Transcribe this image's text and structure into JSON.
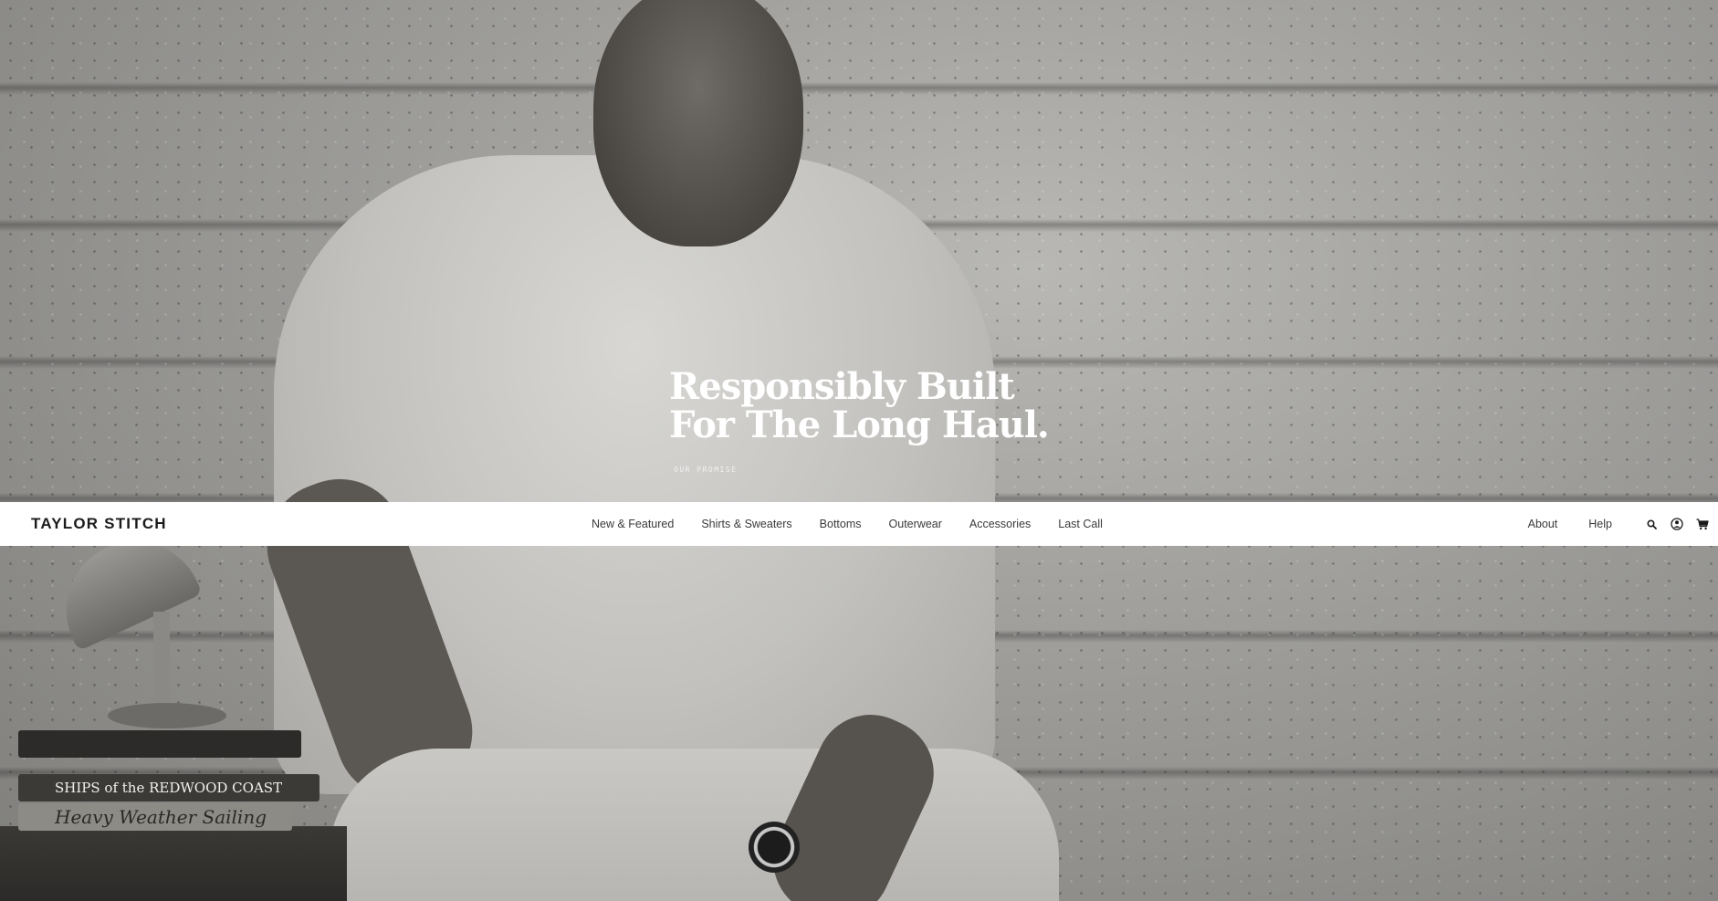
{
  "hero": {
    "headline_line1": "Responsibly Built",
    "headline_line2": "For The Long Haul.",
    "cta_label": "OUR PROMISE",
    "book_titles": [
      "SHIPS of the REDWOOD COAST",
      "Heavy Weather Sailing"
    ]
  },
  "navbar": {
    "logo": "TAYLOR STITCH",
    "main_items": [
      {
        "label": "New & Featured"
      },
      {
        "label": "Shirts & Sweaters"
      },
      {
        "label": "Bottoms"
      },
      {
        "label": "Outerwear"
      },
      {
        "label": "Accessories"
      },
      {
        "label": "Last Call"
      }
    ],
    "secondary_items": [
      {
        "label": "About"
      },
      {
        "label": "Help"
      }
    ],
    "icons": [
      "search-icon",
      "account-icon",
      "cart-icon"
    ]
  },
  "colors": {
    "navbar_bg": "#ffffff",
    "headline_text": "#ffffff",
    "nav_text": "#3a3a3a",
    "logo_text": "#1b1b1b"
  }
}
